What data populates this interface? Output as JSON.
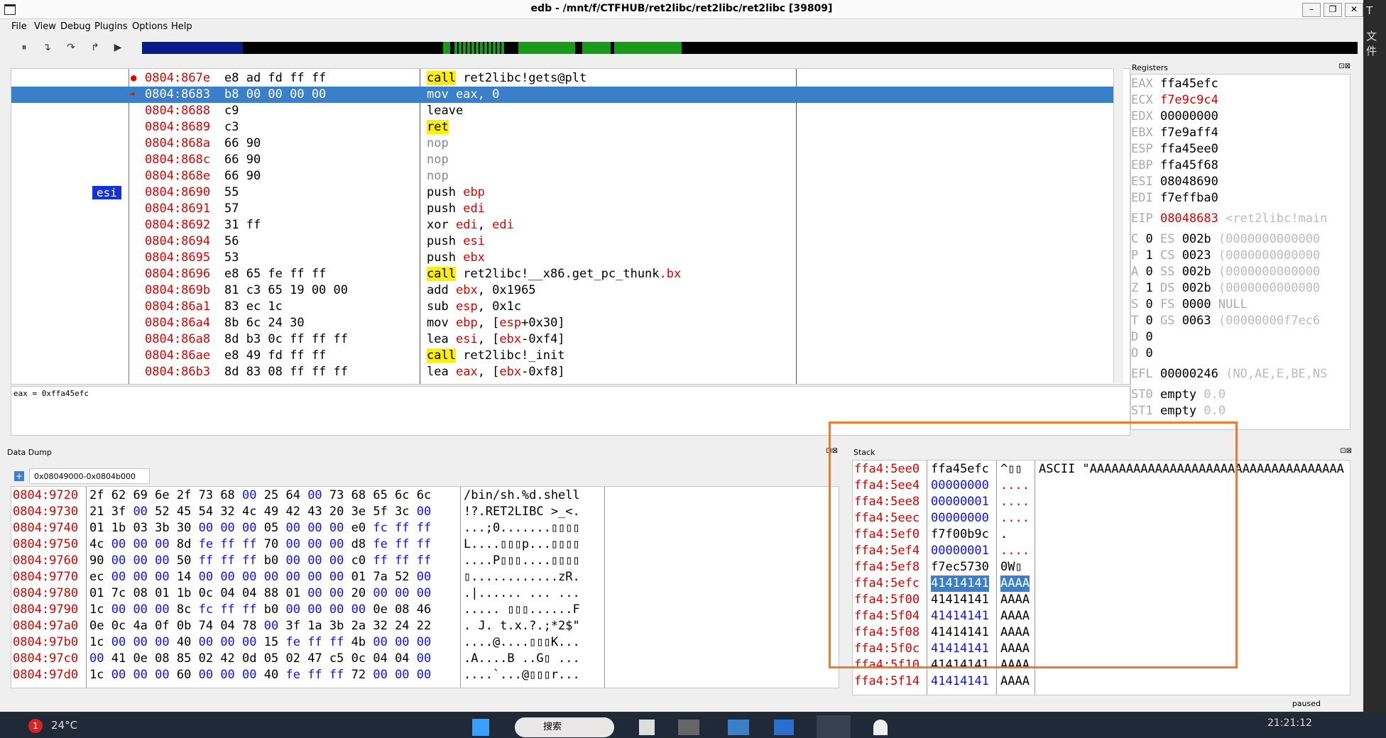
{
  "window": {
    "title": "edb - /mnt/f/CTFHUB/ret2libc/ret2libc/ret2libc [39809]",
    "minimize": "–",
    "maximize": "❐",
    "close": "✕"
  },
  "menu": [
    "File",
    "View",
    "Debug",
    "Plugins",
    "Options",
    "Help"
  ],
  "toolbar": {
    "pause": "⏸",
    "step_into": "↴",
    "step_over": "↷",
    "step_out": "↱",
    "run": "▶"
  },
  "disasm": {
    "rows": [
      {
        "addr": "0804:867e",
        "bytes": "e8 ad fd ff ff",
        "m": "call",
        "o": " ret2libc!gets@plt",
        "bp": true
      },
      {
        "addr": "0804:8683",
        "bytes": "b8 00 00 00 00",
        "m": "mov",
        "o": " eax, 0",
        "ip": true
      },
      {
        "addr": "0804:8688",
        "bytes": "c9",
        "m": "leave",
        "o": ""
      },
      {
        "addr": "0804:8689",
        "bytes": "c3",
        "m": "ret",
        "o": ""
      },
      {
        "addr": "0804:868a",
        "bytes": "66 90",
        "m": "nop",
        "o": ""
      },
      {
        "addr": "0804:868c",
        "bytes": "66 90",
        "m": "nop",
        "o": ""
      },
      {
        "addr": "0804:868e",
        "bytes": "66 90",
        "m": "nop",
        "o": ""
      },
      {
        "addr": "0804:8690",
        "bytes": "55",
        "m": "push",
        "o": " ebp",
        "label": "esi"
      },
      {
        "addr": "0804:8691",
        "bytes": "57",
        "m": "push",
        "o": " edi"
      },
      {
        "addr": "0804:8692",
        "bytes": "31 ff",
        "m": "xor",
        "o": " edi, edi"
      },
      {
        "addr": "0804:8694",
        "bytes": "56",
        "m": "push",
        "o": " esi"
      },
      {
        "addr": "0804:8695",
        "bytes": "53",
        "m": "push",
        "o": " ebx"
      },
      {
        "addr": "0804:8696",
        "bytes": "e8 65 fe ff ff",
        "m": "call",
        "o": " ret2libc!__x86.get_pc_thunk.bx"
      },
      {
        "addr": "0804:869b",
        "bytes": "81 c3 65 19 00 00",
        "m": "add",
        "o": " ebx, 0x1965"
      },
      {
        "addr": "0804:86a1",
        "bytes": "83 ec 1c",
        "m": "sub",
        "o": " esp, 0x1c"
      },
      {
        "addr": "0804:86a4",
        "bytes": "8b 6c 24 30",
        "m": "mov",
        "o": " ebp, [esp+0x30]"
      },
      {
        "addr": "0804:86a8",
        "bytes": "8d b3 0c ff ff ff",
        "m": "lea",
        "o": " esi, [ebx-0xf4]"
      },
      {
        "addr": "0804:86ae",
        "bytes": "e8 49 fd ff ff",
        "m": "call",
        "o": " ret2libc!_init"
      },
      {
        "addr": "0804:86b3",
        "bytes": "8d 83 08 ff ff ff",
        "m": "lea",
        "o": " eax, [ebx-0xf8]"
      }
    ]
  },
  "comment": "eax = 0xffa45efc",
  "registers": {
    "title": "Registers",
    "gp": [
      {
        "n": "EAX",
        "v": "ffa45efc"
      },
      {
        "n": "ECX",
        "v": "f7e9c9c4",
        "chg": true
      },
      {
        "n": "EDX",
        "v": "00000000"
      },
      {
        "n": "EBX",
        "v": "f7e9aff4"
      },
      {
        "n": "ESP",
        "v": "ffa45ee0"
      },
      {
        "n": "EBP",
        "v": "ffa45f68"
      },
      {
        "n": "ESI",
        "v": "08048690"
      },
      {
        "n": "EDI",
        "v": "f7effba0"
      }
    ],
    "eip": {
      "n": "EIP",
      "v": "08048683",
      "c": "<ret2libc!main"
    },
    "flags": [
      {
        "f": "C",
        "fv": "0",
        "s": "ES",
        "sv": "002b",
        "sc": "(0000000000000"
      },
      {
        "f": "P",
        "fv": "1",
        "s": "CS",
        "sv": "0023",
        "sc": "(0000000000000"
      },
      {
        "f": "A",
        "fv": "0",
        "s": "SS",
        "sv": "002b",
        "sc": "(0000000000000"
      },
      {
        "f": "Z",
        "fv": "1",
        "s": "DS",
        "sv": "002b",
        "sc": "(0000000000000"
      },
      {
        "f": "S",
        "fv": "0",
        "s": "FS",
        "sv": "0000",
        "sc": "NULL"
      },
      {
        "f": "T",
        "fv": "0",
        "s": "GS",
        "sv": "0063",
        "sc": "(00000000f7ec6"
      },
      {
        "f": "D",
        "fv": "0",
        "s": "",
        "sv": "",
        "sc": ""
      },
      {
        "f": "O",
        "fv": "0",
        "s": "",
        "sv": "",
        "sc": ""
      }
    ],
    "efl": {
      "n": "EFL",
      "v": "00000246",
      "c": "(NO,AE,E,BE,NS"
    },
    "fpu": [
      {
        "n": "ST0",
        "v": "empty",
        "c": "0.0"
      },
      {
        "n": "ST1",
        "v": "empty",
        "c": "0.0"
      }
    ]
  },
  "dump": {
    "title": "Data Dump",
    "tab": "0x08049000-0x0804b000",
    "rows": [
      {
        "a": "0804:9720",
        "b": "2f 62 69 6e 2f 73 68 00 25 64 00 73 68 65 6c 6c",
        "c": "/bin/sh.%d.shell"
      },
      {
        "a": "0804:9730",
        "b": "21 3f 00 52 45 54 32 4c 49 42 43 20 3e 5f 3c 00",
        "c": "!?.RET2LIBC >_<."
      },
      {
        "a": "0804:9740",
        "b": "01 1b 03 3b 30 00 00 00 05 00 00 00 e0 fc ff ff",
        "c": "...;0.......▯▯▯▯"
      },
      {
        "a": "0804:9750",
        "b": "4c 00 00 00 8d fe ff ff 70 00 00 00 d8 fe ff ff",
        "c": "L....▯▯▯p...▯▯▯▯"
      },
      {
        "a": "0804:9760",
        "b": "90 00 00 00 50 ff ff ff b0 00 00 00 c0 ff ff ff",
        "c": "....P▯▯▯....▯▯▯▯"
      },
      {
        "a": "0804:9770",
        "b": "ec 00 00 00 14 00 00 00 00 00 00 00 01 7a 52 00",
        "c": "▯............zR."
      },
      {
        "a": "0804:9780",
        "b": "01 7c 08 01 1b 0c 04 04 88 01 00 00 20 00 00 00",
        "c": ".|...... ... ..."
      },
      {
        "a": "0804:9790",
        "b": "1c 00 00 00 8c fc ff ff b0 00 00 00 00 0e 08 46",
        "c": "..... ▯▯▯......F"
      },
      {
        "a": "0804:97a0",
        "b": "0e 0c 4a 0f 0b 74 04 78 00 3f 1a 3b 2a 32 24 22",
        "c": ". J. t.x.?.;*2$\""
      },
      {
        "a": "0804:97b0",
        "b": "1c 00 00 00 40 00 00 00 15 fe ff ff 4b 00 00 00",
        "c": "....@....▯▯▯K..."
      },
      {
        "a": "0804:97c0",
        "b": "00 41 0e 08 85 02 42 0d 05 02 47 c5 0c 04 04 00",
        "c": ".A....B ..G▯ ..."
      },
      {
        "a": "0804:97d0",
        "b": "1c 00 00 00 60 00 00 00 40 fe ff ff 72 00 00 00",
        "c": "....`...@▯▯▯r..."
      }
    ]
  },
  "stack": {
    "title": "Stack",
    "rows": [
      {
        "a": "ffa4:5ee0",
        "v": "ffa45efc",
        "c": "^▯▯",
        "m": "ASCII \"AAAAAAAAAAAAAAAAAAAAAAAAAAAAAAAAAAA"
      },
      {
        "a": "ffa4:5ee4",
        "v": "00000000",
        "c": "....",
        "m": ""
      },
      {
        "a": "ffa4:5ee8",
        "v": "00000001",
        "c": "....",
        "m": ""
      },
      {
        "a": "ffa4:5eec",
        "v": "00000000",
        "c": "....",
        "m": ""
      },
      {
        "a": "ffa4:5ef0",
        "v": "f7f00b9c",
        "c": ".",
        "m": ""
      },
      {
        "a": "ffa4:5ef4",
        "v": "00000001",
        "c": "....",
        "m": ""
      },
      {
        "a": "ffa4:5ef8",
        "v": "f7ec5730",
        "c": "0W▯",
        "m": ""
      },
      {
        "a": "ffa4:5efc",
        "v": "41414141",
        "c": "AAAA",
        "m": "",
        "sel": true
      },
      {
        "a": "ffa4:5f00",
        "v": "41414141",
        "c": "AAAA",
        "m": ""
      },
      {
        "a": "ffa4:5f04",
        "v": "41414141",
        "c": "AAAA",
        "m": ""
      },
      {
        "a": "ffa4:5f08",
        "v": "41414141",
        "c": "AAAA",
        "m": ""
      },
      {
        "a": "ffa4:5f0c",
        "v": "41414141",
        "c": "AAAA",
        "m": ""
      },
      {
        "a": "ffa4:5f10",
        "v": "41414141",
        "c": "AAAA",
        "m": ""
      },
      {
        "a": "ffa4:5f14",
        "v": "41414141",
        "c": "AAAA",
        "m": ""
      }
    ]
  },
  "status": "paused",
  "taskbar": {
    "badge": "1",
    "temp": "24°C",
    "search": "搜索",
    "clock": "21:21:12"
  },
  "side": {
    "t1": "T",
    "t2": "文件"
  }
}
